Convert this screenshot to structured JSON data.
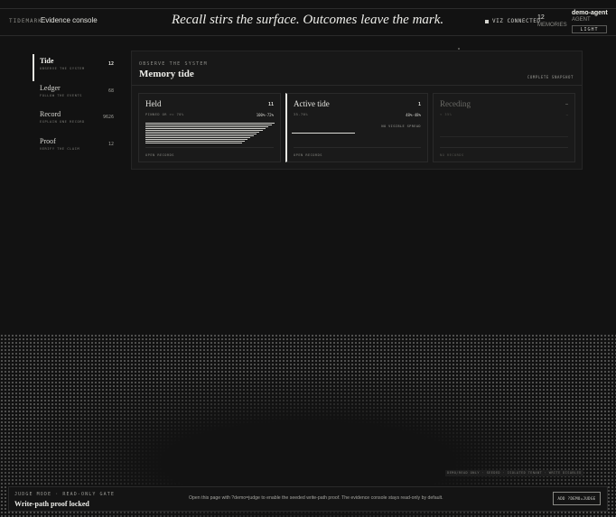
{
  "header": {
    "brand": "TIDEMARK",
    "app_title": "Evidence console",
    "tagline": "Recall stirs the surface. Outcomes leave the mark.",
    "status": "VIZ CONNECTED",
    "memory_count": "12",
    "memory_label": "MEMORIES",
    "agent_name": "demo-agent",
    "agent_role": "AGENT",
    "theme_button": "LIGHT"
  },
  "sidebar": {
    "items": [
      {
        "label": "Tide",
        "sub": "OBSERVE THE SYSTEM",
        "count": "12",
        "active": true
      },
      {
        "label": "Ledger",
        "sub": "FOLLOW THE EVENTS",
        "count": "68",
        "active": false
      },
      {
        "label": "Record",
        "sub": "EXPLAIN ONE RECORD",
        "count": "9626",
        "active": false
      },
      {
        "label": "Proof",
        "sub": "VERIFY THE CLAIM",
        "count": "12",
        "active": false
      }
    ]
  },
  "main": {
    "eyebrow": "OBSERVE THE SYSTEM",
    "title": "Memory tide",
    "snapshot": "COMPLETE SNAPSHOT",
    "cards": [
      {
        "title": "Held",
        "count": "11",
        "meta": "PINNED OR >= 70%",
        "range": "100%-72%",
        "note": "",
        "link": "OPEN RECORDS",
        "bars": [
          1.0,
          0.99,
          0.98,
          0.97,
          0.96,
          0.95,
          0.94,
          0.93,
          0.92,
          0.91,
          0.9,
          0.89
        ]
      },
      {
        "title": "Active tide",
        "count": "1",
        "meta": "35-70%",
        "range": "48%-48%",
        "note": "NO VISIBLE SPREAD",
        "link": "OPEN RECORDS"
      },
      {
        "title": "Receding",
        "count": "—",
        "meta": "< 35%",
        "range": "—",
        "note": "",
        "link": "NO RECORDS"
      }
    ]
  },
  "footer": {
    "note": "DEMO/READ ONLY · SEEDED · ISOLATED TENANT · WRITE DISABLED",
    "judge_eyebrow": "JUDGE MODE · READ-ONLY GATE",
    "judge_title": "Write-path proof locked",
    "judge_desc": "Open this page with ?demo=judge to enable the seeded write-path proof. The evidence console stays read-only by default.",
    "judge_button": "ADD ?DEMO=JUDGE"
  },
  "colors": {
    "background": "#121212",
    "panel": "#181818",
    "accent": "#e8e8e3"
  }
}
